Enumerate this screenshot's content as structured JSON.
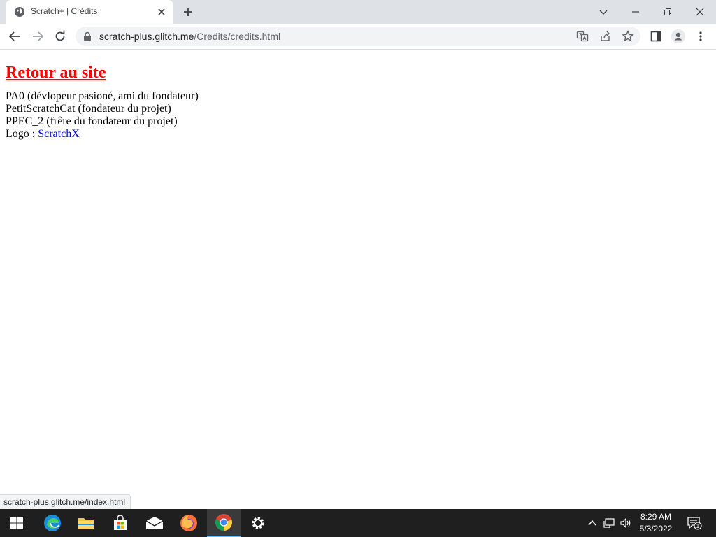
{
  "browser": {
    "tab_title": "Scratch+ | Crédits",
    "url_host": "scratch-plus.glitch.me",
    "url_path": "/Credits/credits.html"
  },
  "page": {
    "back_link": "Retour au site",
    "credits": [
      "PA0 (dévlopeur pasioné, ami du fondateur)",
      "PetitScratchCat (fondateur du projet)",
      "PPEC_2 (frêre du fondateur du projet)"
    ],
    "logo_label": "Logo : ",
    "logo_link": "ScratchX"
  },
  "status_bar": "scratch-plus.glitch.me/index.html",
  "taskbar": {
    "time": "8:29 AM",
    "date": "5/3/2022",
    "notification_count": "1"
  },
  "colors": {
    "back_link": "#ff0000",
    "link": "#0000ee",
    "taskbar": "#1f1f1f"
  }
}
